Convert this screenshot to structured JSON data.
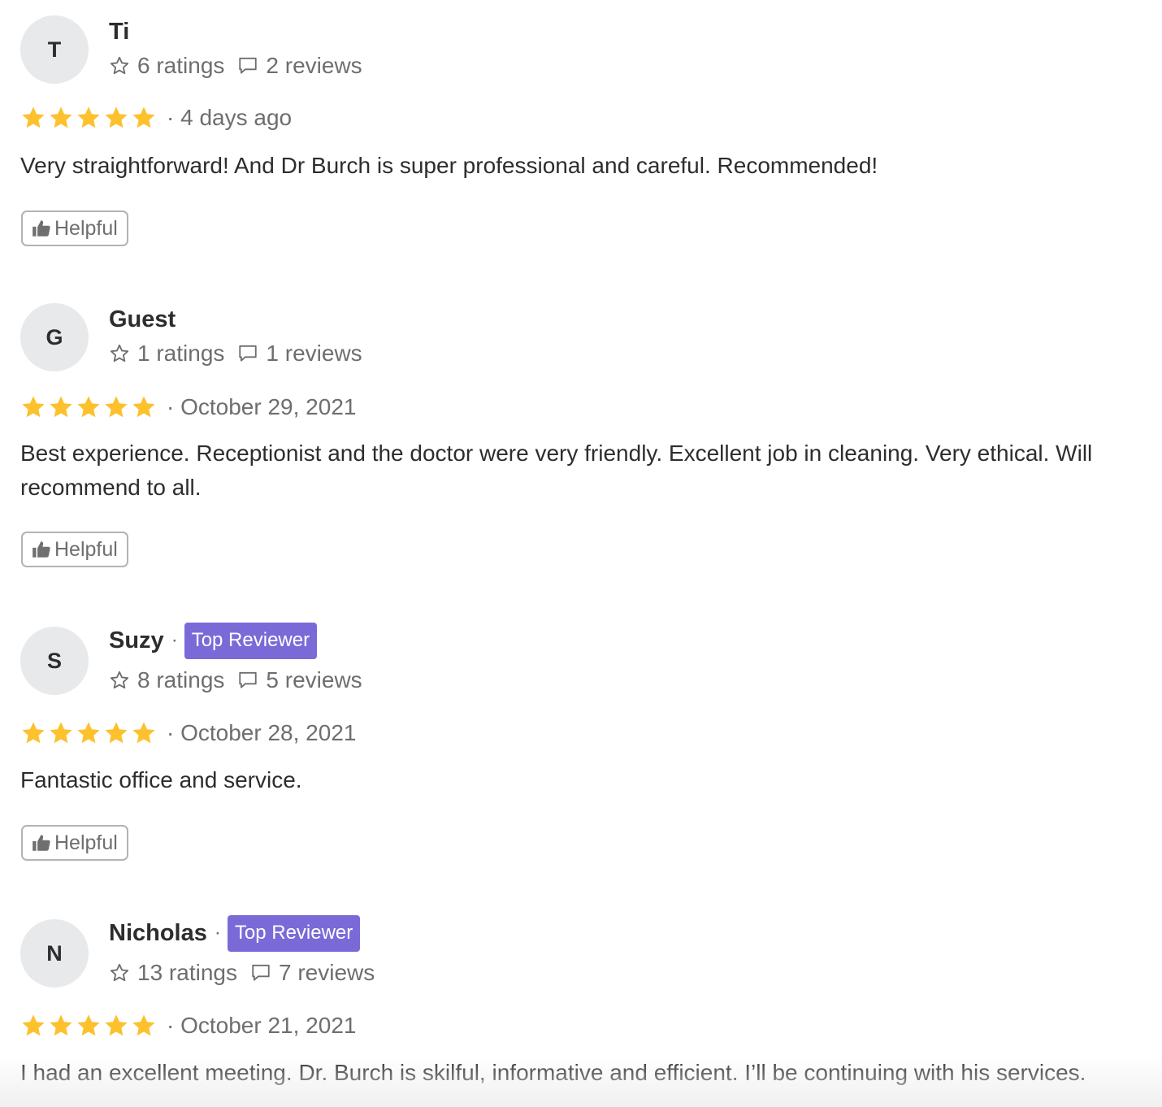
{
  "colors": {
    "star": "#FCC12D",
    "badge": "#7A6AD8",
    "avatar_bg": "#E8E9EB",
    "muted_text": "#6E6E6E"
  },
  "icons": {
    "ratings": "star-outline-icon",
    "reviews": "speech-bubble-icon",
    "helpful": "thumbs-up-icon",
    "rating_star": "filled-star-icon"
  },
  "reviews": [
    {
      "initial": "T",
      "name": "Ti",
      "top_reviewer": false,
      "badge": "",
      "ratings": "6 ratings",
      "reviews": "2 reviews",
      "stars": 5,
      "date": "· 4 days ago",
      "text": "Very straightforward! And Dr Burch is super professional and careful. Recommended!",
      "helpful": "Helpful"
    },
    {
      "initial": "G",
      "name": "Guest",
      "top_reviewer": false,
      "badge": "",
      "ratings": "1 ratings",
      "reviews": "1 reviews",
      "stars": 5,
      "date": "· October 29, 2021",
      "text": "Best experience. Receptionist and the doctor were very friendly. Excellent job in cleaning. Very ethical. Will recommend to all.",
      "helpful": "Helpful"
    },
    {
      "initial": "S",
      "name": "Suzy",
      "top_reviewer": true,
      "badge": "Top Reviewer",
      "ratings": "8 ratings",
      "reviews": "5 reviews",
      "stars": 5,
      "date": "· October 28, 2021",
      "text": "Fantastic office and service.",
      "helpful": "Helpful"
    },
    {
      "initial": "N",
      "name": "Nicholas",
      "top_reviewer": true,
      "badge": "Top Reviewer",
      "ratings": "13 ratings",
      "reviews": "7 reviews",
      "stars": 5,
      "date": "· October 21, 2021",
      "text": "I had an excellent meeting. Dr. Burch is skilful, informative and efficient. I’ll be continuing with his services.",
      "helpful": ""
    }
  ]
}
